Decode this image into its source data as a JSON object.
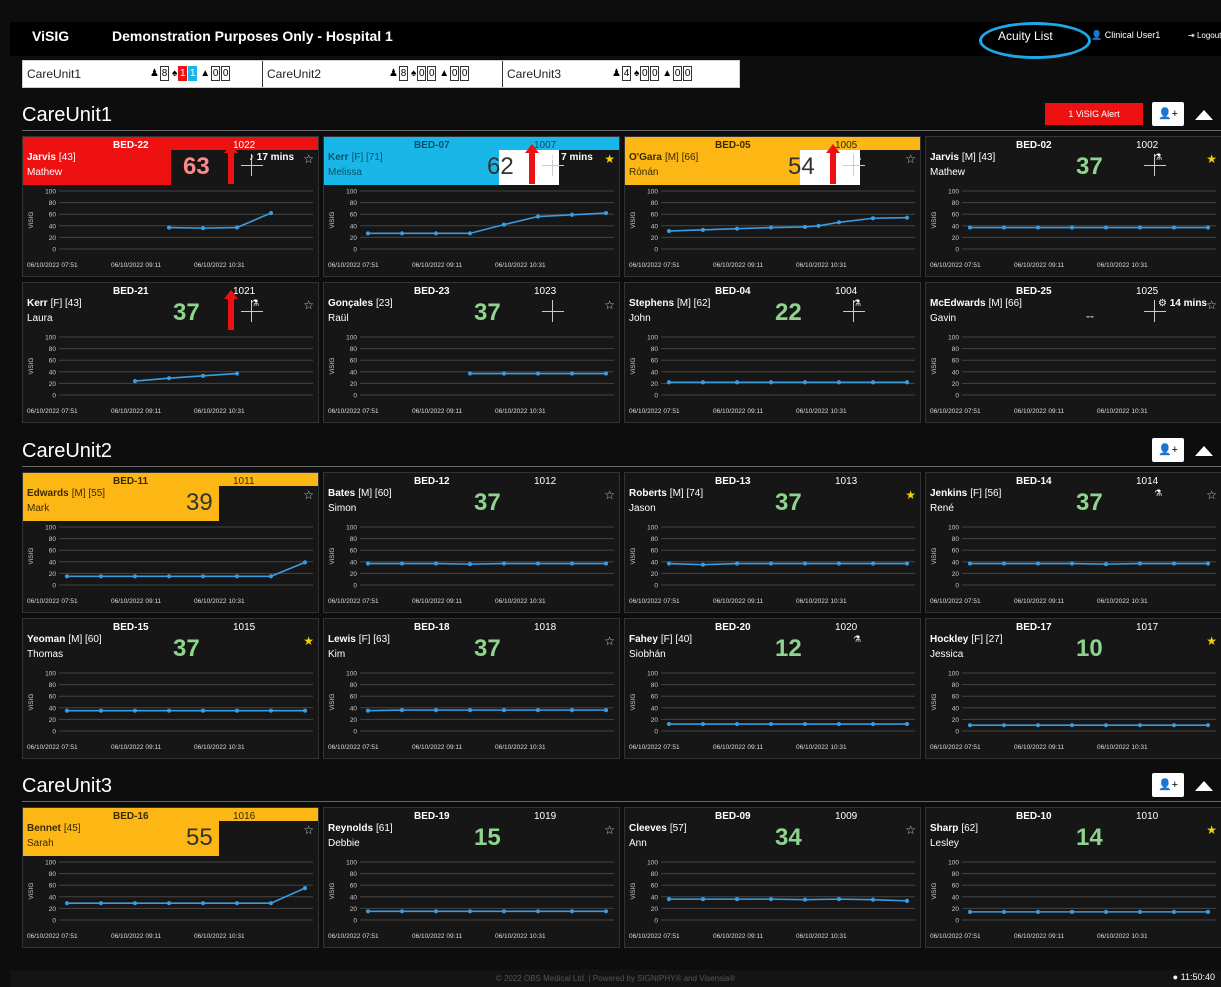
{
  "app": {
    "brand": "ViSIG",
    "title": "Demonstration Purposes Only - Hospital 1",
    "acuity_list": "Acuity List",
    "user": "Clinical User1",
    "logout": "Logout"
  },
  "unit_tabs": [
    {
      "name": "CareUnit1",
      "patients": "8",
      "alerts": "1",
      "alerts_blue": "1",
      "warn1": "0",
      "warn2": "0"
    },
    {
      "name": "CareUnit2",
      "patients": "8",
      "alerts": "0",
      "alerts_blue": "0",
      "warn1": "0",
      "warn2": "0"
    },
    {
      "name": "CareUnit3",
      "patients": "4",
      "alerts": "0",
      "alerts_blue": "0",
      "warn1": "0",
      "warn2": "0"
    }
  ],
  "sections": {
    "u1": {
      "title": "CareUnit1",
      "alert_button": "1 ViSIG Alert"
    },
    "u2": {
      "title": "CareUnit2"
    },
    "u3": {
      "title": "CareUnit3"
    }
  },
  "chart_axis": {
    "y_ticks": [
      "100",
      "80",
      "60",
      "40",
      "20",
      "0"
    ],
    "y_label": "ViSIG",
    "x_ticks": [
      "06/10/2022 07:51",
      "06/10/2022 09:11",
      "06/10/2022 10:31"
    ]
  },
  "cards": [
    {
      "bed": "BED-22",
      "bedno": "1022",
      "surname": "Jarvis",
      "detail": "[43]",
      "first": "Mathew",
      "score": "63",
      "style": "red",
      "arrow": true,
      "timer": "17 mins",
      "timer_icon": "bell",
      "star": "white",
      "series": [
        [
          3,
          37
        ],
        [
          4,
          36
        ],
        [
          5,
          37
        ],
        [
          6,
          62
        ]
      ]
    },
    {
      "bed": "BED-07",
      "bedno": "1007",
      "surname": "Kerr",
      "detail": "[F] [71]",
      "first": "Melissa",
      "score": "62",
      "style": "blue",
      "arrow": true,
      "timer": "7 mins",
      "timer_icon": "bell-slash",
      "star": "gold",
      "series": [
        [
          0,
          27
        ],
        [
          1,
          27
        ],
        [
          2,
          27
        ],
        [
          3,
          27
        ],
        [
          4,
          42
        ],
        [
          5,
          56
        ],
        [
          6,
          59
        ],
        [
          7,
          62
        ]
      ]
    },
    {
      "bed": "BED-05",
      "bedno": "1005",
      "surname": "O'Gara",
      "detail": "[M] [66]",
      "first": "Rónán",
      "score": "54",
      "style": "amber",
      "arrow": true,
      "star": "white",
      "o2": true,
      "series": [
        [
          0,
          31
        ],
        [
          1,
          33
        ],
        [
          2,
          35
        ],
        [
          3,
          37
        ],
        [
          4,
          38
        ],
        [
          4.4,
          40
        ],
        [
          5,
          46
        ],
        [
          6,
          53
        ],
        [
          7,
          54
        ]
      ]
    },
    {
      "bed": "BED-02",
      "bedno": "1002",
      "surname": "Jarvis",
      "detail": "[M] [43]",
      "first": "Mathew",
      "score": "37",
      "style": "plain",
      "cross": true,
      "o2": true,
      "star": "gold",
      "series": [
        [
          0,
          37
        ],
        [
          1,
          37
        ],
        [
          2,
          37
        ],
        [
          3,
          37
        ],
        [
          4,
          37
        ],
        [
          5,
          37
        ],
        [
          6,
          37
        ],
        [
          7,
          37
        ]
      ]
    },
    {
      "bed": "BED-21",
      "bedno": "1021",
      "surname": "Kerr",
      "detail": "[F] [43]",
      "first": "Laura",
      "score": "37",
      "style": "plain",
      "arrow": true,
      "o2": true,
      "star": "white",
      "series": [
        [
          2,
          24
        ],
        [
          3,
          29
        ],
        [
          4,
          33
        ],
        [
          5,
          37
        ]
      ]
    },
    {
      "bed": "BED-23",
      "bedno": "1023",
      "surname": "Gonçales",
      "detail": "[23]",
      "first": "Raül",
      "score": "37",
      "style": "plain",
      "cross": true,
      "star": "white",
      "series": [
        [
          3,
          37
        ],
        [
          4,
          37
        ],
        [
          5,
          37
        ],
        [
          6,
          37
        ],
        [
          7,
          37
        ]
      ]
    },
    {
      "bed": "BED-04",
      "bedno": "1004",
      "surname": "Stephens",
      "detail": "[M] [62]",
      "first": "John",
      "score": "22",
      "style": "plain",
      "cross": true,
      "o2": true,
      "star": "none",
      "series": [
        [
          0,
          22
        ],
        [
          1,
          22
        ],
        [
          2,
          22
        ],
        [
          3,
          22
        ],
        [
          4,
          22
        ],
        [
          5,
          22
        ],
        [
          6,
          22
        ],
        [
          7,
          22
        ]
      ]
    },
    {
      "bed": "BED-25",
      "bedno": "1025",
      "surname": "McEdwards",
      "detail": "[M] [66]",
      "first": "Gavin",
      "score": "--",
      "style": "plain",
      "cross": true,
      "timer": "14 mins",
      "timer_icon": "gear",
      "star": "white",
      "series": []
    },
    {
      "bed": "BED-11",
      "bedno": "1011",
      "surname": "Edwards",
      "detail": "[M] [55]",
      "first": "Mark",
      "score": "39",
      "style": "amber",
      "star": "white",
      "series": [
        [
          0,
          15
        ],
        [
          1,
          15
        ],
        [
          2,
          15
        ],
        [
          3,
          15
        ],
        [
          4,
          15
        ],
        [
          5,
          15
        ],
        [
          6,
          15
        ],
        [
          7,
          39
        ]
      ]
    },
    {
      "bed": "BED-12",
      "bedno": "1012",
      "surname": "Bates",
      "detail": "[M] [60]",
      "first": "Simon",
      "score": "37",
      "style": "plain",
      "star": "white",
      "series": [
        [
          0,
          37
        ],
        [
          1,
          37
        ],
        [
          2,
          37
        ],
        [
          3,
          36
        ],
        [
          4,
          37
        ],
        [
          5,
          37
        ],
        [
          6,
          37
        ],
        [
          7,
          37
        ]
      ]
    },
    {
      "bed": "BED-13",
      "bedno": "1013",
      "surname": "Roberts",
      "detail": "[M] [74]",
      "first": "Jason",
      "score": "37",
      "style": "plain",
      "star": "gold",
      "series": [
        [
          0,
          37
        ],
        [
          1,
          35
        ],
        [
          2,
          37
        ],
        [
          3,
          37
        ],
        [
          4,
          37
        ],
        [
          5,
          37
        ],
        [
          6,
          37
        ],
        [
          7,
          37
        ]
      ]
    },
    {
      "bed": "BED-14",
      "bedno": "1014",
      "surname": "Jenkins",
      "detail": "[F] [56]",
      "first": "René",
      "score": "37",
      "style": "plain",
      "o2": true,
      "star": "white",
      "series": [
        [
          0,
          37
        ],
        [
          1,
          37
        ],
        [
          2,
          37
        ],
        [
          3,
          37
        ],
        [
          4,
          36
        ],
        [
          5,
          37
        ],
        [
          6,
          37
        ],
        [
          7,
          37
        ]
      ]
    },
    {
      "bed": "BED-15",
      "bedno": "1015",
      "surname": "Yeoman",
      "detail": "[M] [60]",
      "first": "Thomas",
      "score": "37",
      "style": "plain",
      "star": "gold",
      "series": [
        [
          0,
          35
        ],
        [
          1,
          35
        ],
        [
          2,
          35
        ],
        [
          3,
          35
        ],
        [
          4,
          35
        ],
        [
          5,
          35
        ],
        [
          6,
          35
        ],
        [
          7,
          35
        ]
      ]
    },
    {
      "bed": "BED-18",
      "bedno": "1018",
      "surname": "Lewis",
      "detail": "[F] [63]",
      "first": "Kim",
      "score": "37",
      "style": "plain",
      "star": "white",
      "series": [
        [
          0,
          35
        ],
        [
          1,
          36
        ],
        [
          2,
          36
        ],
        [
          3,
          36
        ],
        [
          4,
          36
        ],
        [
          5,
          36
        ],
        [
          6,
          36
        ],
        [
          7,
          36
        ]
      ]
    },
    {
      "bed": "BED-20",
      "bedno": "1020",
      "surname": "Fahey",
      "detail": "[F] [40]",
      "first": "Siobhán",
      "score": "12",
      "style": "plain",
      "o2": true,
      "star": "none",
      "series": [
        [
          0,
          12
        ],
        [
          1,
          12
        ],
        [
          2,
          12
        ],
        [
          3,
          12
        ],
        [
          4,
          12
        ],
        [
          5,
          12
        ],
        [
          6,
          12
        ],
        [
          7,
          12
        ]
      ]
    },
    {
      "bed": "BED-17",
      "bedno": "1017",
      "surname": "Hockley",
      "detail": "[F] [27]",
      "first": "Jessica",
      "score": "10",
      "style": "plain",
      "star": "gold",
      "series": [
        [
          0,
          10
        ],
        [
          1,
          10
        ],
        [
          2,
          10
        ],
        [
          3,
          10
        ],
        [
          4,
          10
        ],
        [
          5,
          10
        ],
        [
          6,
          10
        ],
        [
          7,
          10
        ]
      ]
    },
    {
      "bed": "BED-16",
      "bedno": "1016",
      "surname": "Bennet",
      "detail": "[45]",
      "first": "Sarah",
      "score": "55",
      "style": "amber",
      "star": "white",
      "series": [
        [
          0,
          29
        ],
        [
          1,
          29
        ],
        [
          2,
          29
        ],
        [
          3,
          29
        ],
        [
          4,
          29
        ],
        [
          5,
          29
        ],
        [
          6,
          29
        ],
        [
          7,
          55
        ]
      ]
    },
    {
      "bed": "BED-19",
      "bedno": "1019",
      "surname": "Reynolds",
      "detail": "[61]",
      "first": "Debbie",
      "score": "15",
      "style": "plain",
      "star": "white",
      "series": [
        [
          0,
          15
        ],
        [
          1,
          15
        ],
        [
          2,
          15
        ],
        [
          3,
          15
        ],
        [
          4,
          15
        ],
        [
          5,
          15
        ],
        [
          6,
          15
        ],
        [
          7,
          15
        ]
      ]
    },
    {
      "bed": "BED-09",
      "bedno": "1009",
      "surname": "Cleeves",
      "detail": "[57]",
      "first": "Ann",
      "score": "34",
      "style": "plain",
      "star": "white",
      "series": [
        [
          0,
          36
        ],
        [
          1,
          36
        ],
        [
          2,
          36
        ],
        [
          3,
          36
        ],
        [
          4,
          35
        ],
        [
          5,
          36
        ],
        [
          6,
          35
        ],
        [
          7,
          33
        ]
      ]
    },
    {
      "bed": "BED-10",
      "bedno": "1010",
      "surname": "Sharp",
      "detail": "[62]",
      "first": "Lesley",
      "score": "14",
      "style": "plain",
      "star": "gold",
      "series": [
        [
          0,
          14
        ],
        [
          1,
          14
        ],
        [
          2,
          14
        ],
        [
          3,
          14
        ],
        [
          4,
          14
        ],
        [
          5,
          14
        ],
        [
          6,
          14
        ],
        [
          7,
          14
        ]
      ]
    }
  ],
  "footer": "© 2022 OBS Medical Ltd. | Powered by SIGNIPHY® and Visensia®",
  "clock": "11:50:40",
  "colors": {
    "alert_red": "#ee1111",
    "alert_blue": "#19b7e8",
    "alert_amber": "#fcb714",
    "line": "#3a9be0",
    "score_green": "#8ed48e",
    "acuity_ring": "#1ca9e8"
  }
}
